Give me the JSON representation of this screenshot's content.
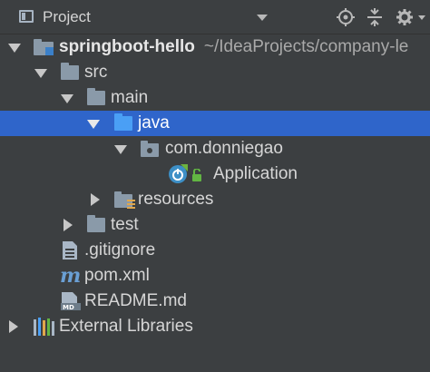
{
  "toolbar": {
    "title": "Project",
    "icons": [
      "project-view-icon",
      "chevron-down-icon",
      "locate-icon",
      "collapse-all-icon",
      "gear-icon"
    ]
  },
  "tree": {
    "root": {
      "name": "springboot-hello",
      "path": "~/IdeaProjects/company-le"
    },
    "src": "src",
    "main": "main",
    "java": "java",
    "package": "com.donniegao",
    "app_class": "Application",
    "resources": "resources",
    "test": "test",
    "gitignore": ".gitignore",
    "pom": "pom.xml",
    "readme": "README.md",
    "external_libraries": "External Libraries"
  },
  "colors": {
    "background": "#3c3f41",
    "selection": "#2f65ca",
    "folder": "#8a9aa9",
    "source_folder": "#4a9ff5",
    "text": "#d6d6d6"
  }
}
